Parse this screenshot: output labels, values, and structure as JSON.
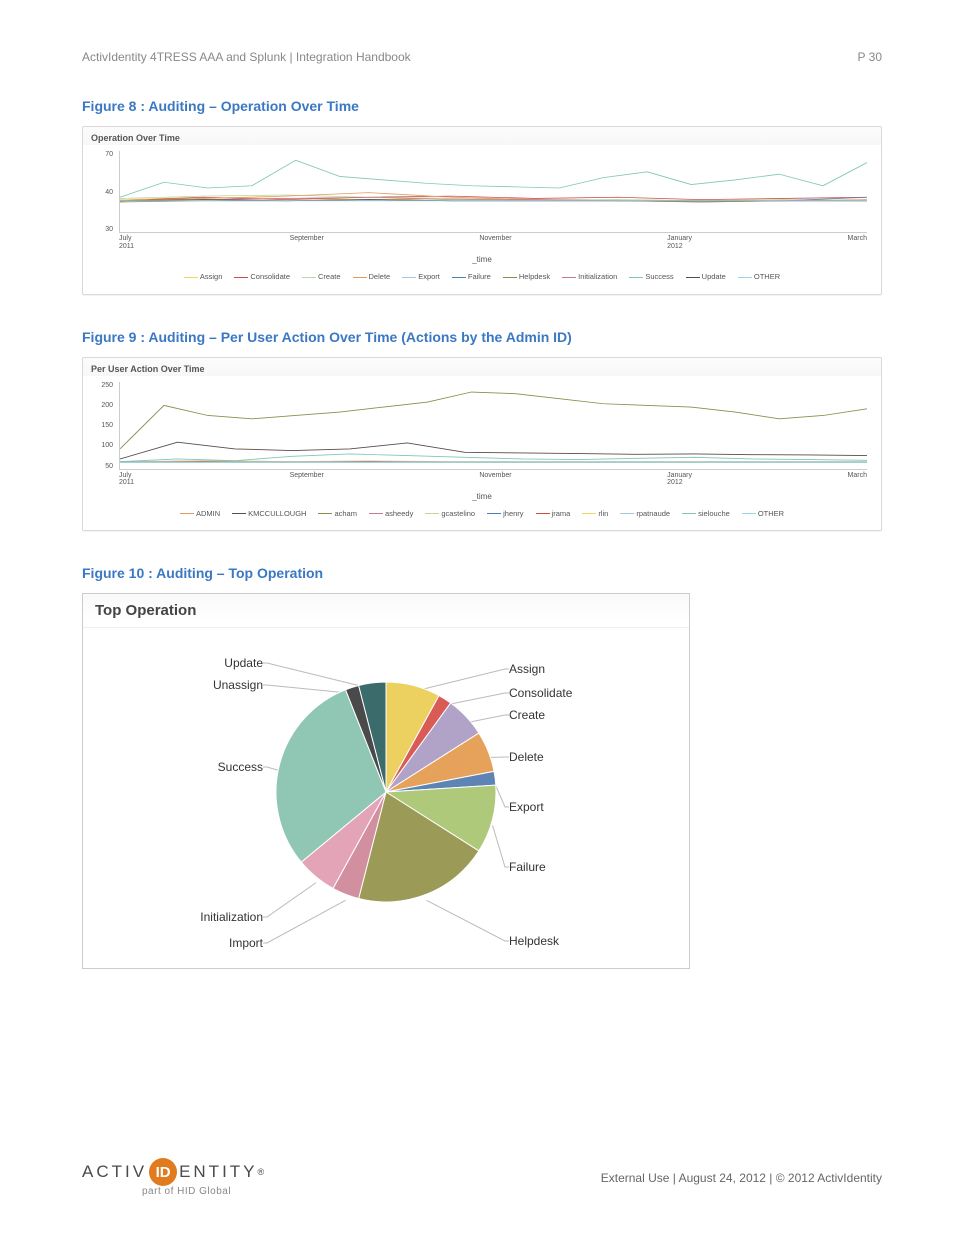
{
  "header": {
    "left": "ActivIdentity 4TRESS AAA and Splunk | Integration Handbook",
    "right": "P 30"
  },
  "fig8": {
    "caption": "Figure 8 : Auditing – Operation Over Time"
  },
  "fig9": {
    "caption": "Figure 9 : Auditing – Per User Action Over Time (Actions by the Admin ID)"
  },
  "fig10": {
    "caption": "Figure 10 : Auditing – Top Operation"
  },
  "chart1": {
    "title": "Operation Over Time",
    "axis_title": "_time"
  },
  "chart2": {
    "title": "Per User Action Over Time",
    "axis_title": "_time"
  },
  "chart3": {
    "title": "Top Operation"
  },
  "footer": {
    "text": "External Use | August 24, 2012 | © 2012 ActivIdentity",
    "logo_sub": "part of HID Global"
  },
  "chart_data": [
    {
      "type": "line",
      "title": "Operation Over Time",
      "xlabel": "_time",
      "ylabel": "",
      "ylim": [
        0,
        70
      ],
      "x_ticks": [
        "July\n2011",
        "September",
        "November",
        "January\n2012",
        "March"
      ],
      "y_ticks": [
        30,
        40,
        70
      ],
      "series": [
        {
          "name": "Assign",
          "color": "#f4d35e",
          "values": [
            28,
            30,
            29,
            28,
            29,
            27,
            28,
            27,
            28,
            27
          ]
        },
        {
          "name": "Consolidate",
          "color": "#c94f4f",
          "values": [
            27,
            30,
            28,
            30,
            31,
            29,
            30,
            28,
            29,
            30
          ]
        },
        {
          "name": "Create",
          "color": "#b8d8a7",
          "values": [
            29,
            31,
            32,
            30,
            29,
            28,
            28,
            27,
            28,
            27
          ]
        },
        {
          "name": "Delete",
          "color": "#e39a5a",
          "values": [
            27,
            29,
            31,
            34,
            30,
            28,
            27,
            26,
            27,
            28
          ]
        },
        {
          "name": "Export",
          "color": "#a6c9e2",
          "values": [
            27,
            27,
            27,
            27,
            27,
            27,
            27,
            27,
            27,
            27
          ]
        },
        {
          "name": "Failure",
          "color": "#4f7fb0",
          "values": [
            27,
            28,
            27,
            28,
            27,
            27,
            27,
            27,
            27,
            30
          ]
        },
        {
          "name": "Helpdesk",
          "color": "#8c8c4f",
          "values": [
            26,
            27,
            27,
            28,
            27,
            27,
            27,
            26,
            27,
            27
          ]
        },
        {
          "name": "Initialization",
          "color": "#c97a8b",
          "values": [
            27,
            28,
            29,
            30,
            28,
            28,
            27,
            27,
            27,
            27
          ]
        },
        {
          "name": "Success",
          "color": "#7fc6b8",
          "values": [
            30,
            43,
            38,
            40,
            62,
            48,
            45,
            42,
            40,
            39,
            38,
            47,
            52,
            41,
            45,
            50,
            40,
            60
          ]
        },
        {
          "name": "Update",
          "color": "#5a4a4a",
          "values": [
            27,
            28,
            27,
            28,
            27,
            27,
            27,
            27,
            27,
            27
          ]
        },
        {
          "name": "OTHER",
          "color": "#9dd3e6",
          "values": [
            27,
            27,
            27,
            27,
            27,
            27,
            27,
            27,
            27,
            27
          ]
        }
      ]
    },
    {
      "type": "line",
      "title": "Per User Action Over Time",
      "xlabel": "_time",
      "ylabel": "",
      "ylim": [
        0,
        260
      ],
      "x_ticks": [
        "July\n2011",
        "September",
        "November",
        "January\n2012",
        "March"
      ],
      "y_ticks": [
        50,
        100,
        150,
        200,
        250
      ],
      "series": [
        {
          "name": "ADMIN",
          "color": "#e39a5a",
          "values": [
            20,
            25,
            22,
            20,
            20,
            20,
            20,
            20,
            20,
            20
          ]
        },
        {
          "name": "KMCCULLOUGH",
          "color": "#5a4a4a",
          "values": [
            30,
            80,
            60,
            55,
            60,
            78,
            50,
            48,
            46,
            44,
            45,
            43,
            42,
            40
          ]
        },
        {
          "name": "acham",
          "color": "#8c8c4f",
          "values": [
            60,
            190,
            160,
            150,
            160,
            170,
            185,
            200,
            230,
            225,
            210,
            195,
            190,
            185,
            170,
            150,
            160,
            180
          ]
        },
        {
          "name": "asheedy",
          "color": "#c97a8b",
          "values": [
            20,
            22,
            20,
            22,
            20,
            20,
            20,
            20,
            20,
            20
          ]
        },
        {
          "name": "gcastelino",
          "color": "#b8d8a7",
          "values": [
            22,
            24,
            22,
            24,
            22,
            22,
            22,
            22,
            22,
            22
          ]
        },
        {
          "name": "jhenry",
          "color": "#4f7fb0",
          "values": [
            20,
            20,
            20,
            20,
            20,
            20,
            20,
            20,
            20,
            20
          ]
        },
        {
          "name": "jrama",
          "color": "#c94f4f",
          "values": [
            20,
            22,
            20,
            22,
            20,
            20,
            20,
            20,
            20,
            20
          ]
        },
        {
          "name": "rlin",
          "color": "#f4d35e",
          "values": [
            20,
            20,
            20,
            20,
            20,
            20,
            20,
            20,
            20,
            20
          ]
        },
        {
          "name": "rpatnaude",
          "color": "#a6c9e2",
          "values": [
            20,
            20,
            20,
            20,
            20,
            20,
            20,
            20,
            20,
            20
          ]
        },
        {
          "name": "sielouche",
          "color": "#7fc6b8",
          "values": [
            22,
            30,
            25,
            38,
            45,
            40,
            35,
            30,
            28,
            32,
            35,
            30,
            28,
            26
          ]
        },
        {
          "name": "OTHER",
          "color": "#9dd3e6",
          "values": [
            20,
            20,
            20,
            20,
            20,
            20,
            20,
            20,
            20,
            20
          ]
        }
      ]
    },
    {
      "type": "pie",
      "title": "Top Operation",
      "series": [
        {
          "name": "Assign",
          "color": "#edd160",
          "value": 8
        },
        {
          "name": "Consolidate",
          "color": "#d85b56",
          "value": 2
        },
        {
          "name": "Create",
          "color": "#b1a2c7",
          "value": 6
        },
        {
          "name": "Delete",
          "color": "#e6a15a",
          "value": 6
        },
        {
          "name": "Export",
          "color": "#5d84b4",
          "value": 2
        },
        {
          "name": "Failure",
          "color": "#aec97a",
          "value": 10
        },
        {
          "name": "Helpdesk",
          "color": "#9b9b57",
          "value": 20
        },
        {
          "name": "Import",
          "color": "#d18fa0",
          "value": 4
        },
        {
          "name": "Initialization",
          "color": "#e4a4b8",
          "value": 6
        },
        {
          "name": "Success",
          "color": "#8fc7b4",
          "value": 30
        },
        {
          "name": "Unassign",
          "color": "#4a4a4a",
          "value": 2
        },
        {
          "name": "Update",
          "color": "#3b6b6b",
          "value": 4
        }
      ]
    }
  ]
}
